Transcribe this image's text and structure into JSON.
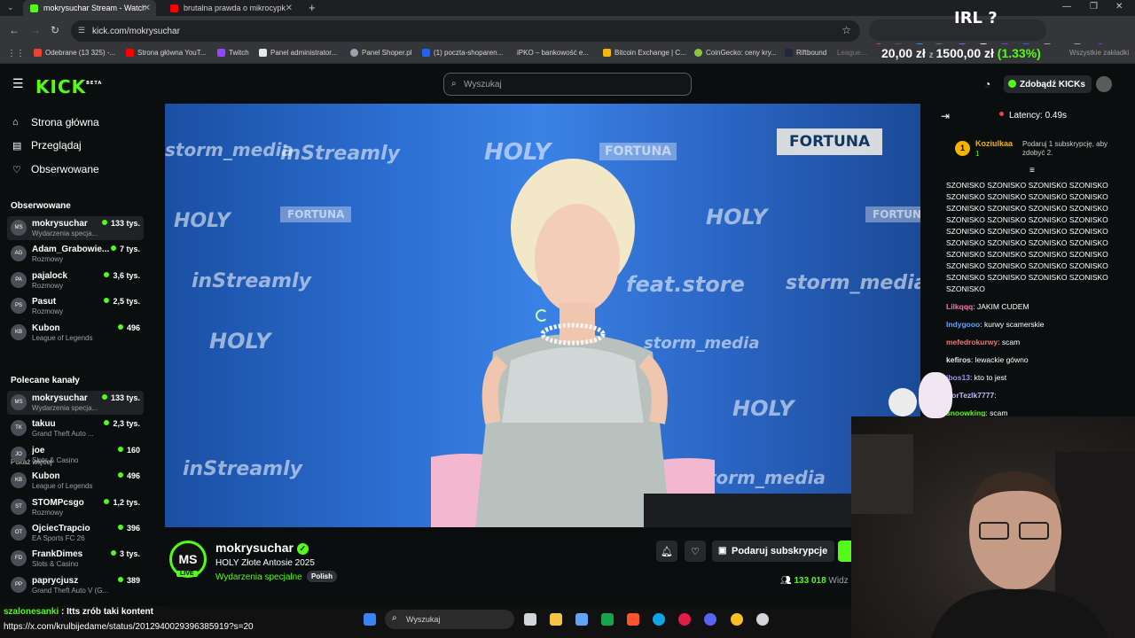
{
  "browser": {
    "tabs": [
      {
        "title": "mokrysuchar Stream - Watch Li",
        "active": true
      },
      {
        "title": "brutalna prawda o mikrocypku",
        "active": false
      }
    ],
    "url": "kick.com/mokrysuchar",
    "bookmarks": [
      "Odebrane (13 325) -...",
      "Strona główna YouT...",
      "Twitch",
      "Panel administrator...",
      "Panel Shoper.pl",
      "(1) poczta-shoparen...",
      "iPKO – bankowość e...",
      "Bitcoin Exchange | C...",
      "CoinGecko: ceny kry...",
      "Riftbound",
      "League...",
      "Wszystkie zakładki"
    ],
    "irl_overlay": "IRL ?",
    "donation_overlay": {
      "left": "20,00 zł",
      "right": "1500,00 zł",
      "pct": "(1.33%)"
    }
  },
  "kick": {
    "logo": "KICK",
    "logo_beta": "BETA",
    "search_placeholder": "Wyszukaj",
    "get_kicks": "Zdobądź KICKs"
  },
  "sidebar": {
    "nav": [
      {
        "label": "Strona główna",
        "icon": "home-icon"
      },
      {
        "label": "Przeglądaj",
        "icon": "browse-icon"
      },
      {
        "label": "Obserwowane",
        "icon": "heart-icon"
      }
    ],
    "followed_title": "Obserwowane",
    "followed": [
      {
        "name": "mokrysuchar",
        "category": "Wydarzenia specja...",
        "viewers": "133 tys.",
        "avatar": "MS"
      },
      {
        "name": "Adam_Grabowie...",
        "category": "Rozmowy",
        "viewers": "7 tys.",
        "avatar": "AG"
      },
      {
        "name": "pajalock",
        "category": "Rozmowy",
        "viewers": "3,6 tys.",
        "avatar": "PA"
      },
      {
        "name": "Pasut",
        "category": "Rozmowy",
        "viewers": "2,5 tys.",
        "avatar": "PS"
      },
      {
        "name": "Kubon",
        "category": "League of Legends",
        "viewers": "496",
        "avatar": "KB"
      }
    ],
    "show_more": "Pokaż więcej",
    "recommended_title": "Polecane kanały",
    "recommended": [
      {
        "name": "mokrysuchar",
        "category": "Wydarzenia specja...",
        "viewers": "133 tys.",
        "avatar": "MS"
      },
      {
        "name": "takuu",
        "category": "Grand Theft Auto ...",
        "viewers": "2,3 tys.",
        "avatar": "TK"
      },
      {
        "name": "joe",
        "category": "Slots & Casino",
        "viewers": "160",
        "avatar": "JO"
      },
      {
        "name": "Kubon",
        "category": "League of Legends",
        "viewers": "496",
        "avatar": "KB"
      },
      {
        "name": "STOMPcsgo",
        "category": "Rozmowy",
        "viewers": "1,2 tys.",
        "avatar": "ST"
      },
      {
        "name": "OjciecTrapcio",
        "category": "EA Sports FC 26",
        "viewers": "396",
        "avatar": "OT"
      },
      {
        "name": "FrankDimes",
        "category": "Slots & Casino",
        "viewers": "3 tys.",
        "avatar": "FD"
      },
      {
        "name": "paprycjusz",
        "category": "Grand Theft Auto V (G...",
        "viewers": "389",
        "avatar": "PP"
      }
    ]
  },
  "video": {
    "watermarks": [
      "FORTUNA",
      "inStreamly",
      "HOLY",
      "feat.store",
      "storm_media"
    ]
  },
  "stream": {
    "avatar": "MS",
    "live": "LIVE",
    "name": "mokrysuchar",
    "title": "HOLY Złote Antosie 2025",
    "category": "Wydarzenia specjalne",
    "language": "Polish",
    "subscribe_label": "Podaruj subskrypcje",
    "viewers": "133 018",
    "viewers_suffix": "Widz"
  },
  "chat": {
    "latency": "Latency: 0.49s",
    "pinned_user": "Koziulkaa",
    "pinned_badge": "1",
    "pinned_text": "Podaruj 1 subskrypcję, aby zdobyć 2.",
    "spam": "SZONISKO SZONISKO SZONISKO SZONISKO SZONISKO SZONISKO SZONISKO SZONISKO SZONISKO SZONISKO SZONISKO SZONISKO SZONISKO SZONISKO SZONISKO SZONISKO SZONISKO SZONISKO SZONISKO SZONISKO SZONISKO SZONISKO SZONISKO SZONISKO SZONISKO SZONISKO SZONISKO SZONISKO SZONISKO SZONISKO SZONISKO SZONISKO SZONISKO SZONISKO SZONISKO SZONISKO SZONISKO",
    "messages": [
      {
        "user": "Lilkqqq",
        "text": "JAKIM CUDEM",
        "color": "#f472b6"
      },
      {
        "user": "Indygooo",
        "text": "kurwy scamerskie",
        "color": "#60a5fa"
      },
      {
        "user": "mefedrokurwy",
        "text": "scam",
        "color": "#f87171"
      },
      {
        "user": "kefiros",
        "text": "lewackie gówno",
        "color": "#e5e7eb"
      },
      {
        "user": "ibos13",
        "text": "kto to jest",
        "color": "#a78bfa"
      },
      {
        "user": "CorTezlk7777",
        "text": "",
        "color": "#c4b5fd"
      },
      {
        "user": "snoowking",
        "text": "scam",
        "color": "#53fc18"
      }
    ]
  },
  "overlay": {
    "message_user": "szalonesanki",
    "message_text": ": Itts zrób taki kontent",
    "message_url": "https://x.com/krulbijedame/status/2012940029396385919?s=20"
  },
  "taskbar": {
    "search": "Wyszukaj"
  }
}
